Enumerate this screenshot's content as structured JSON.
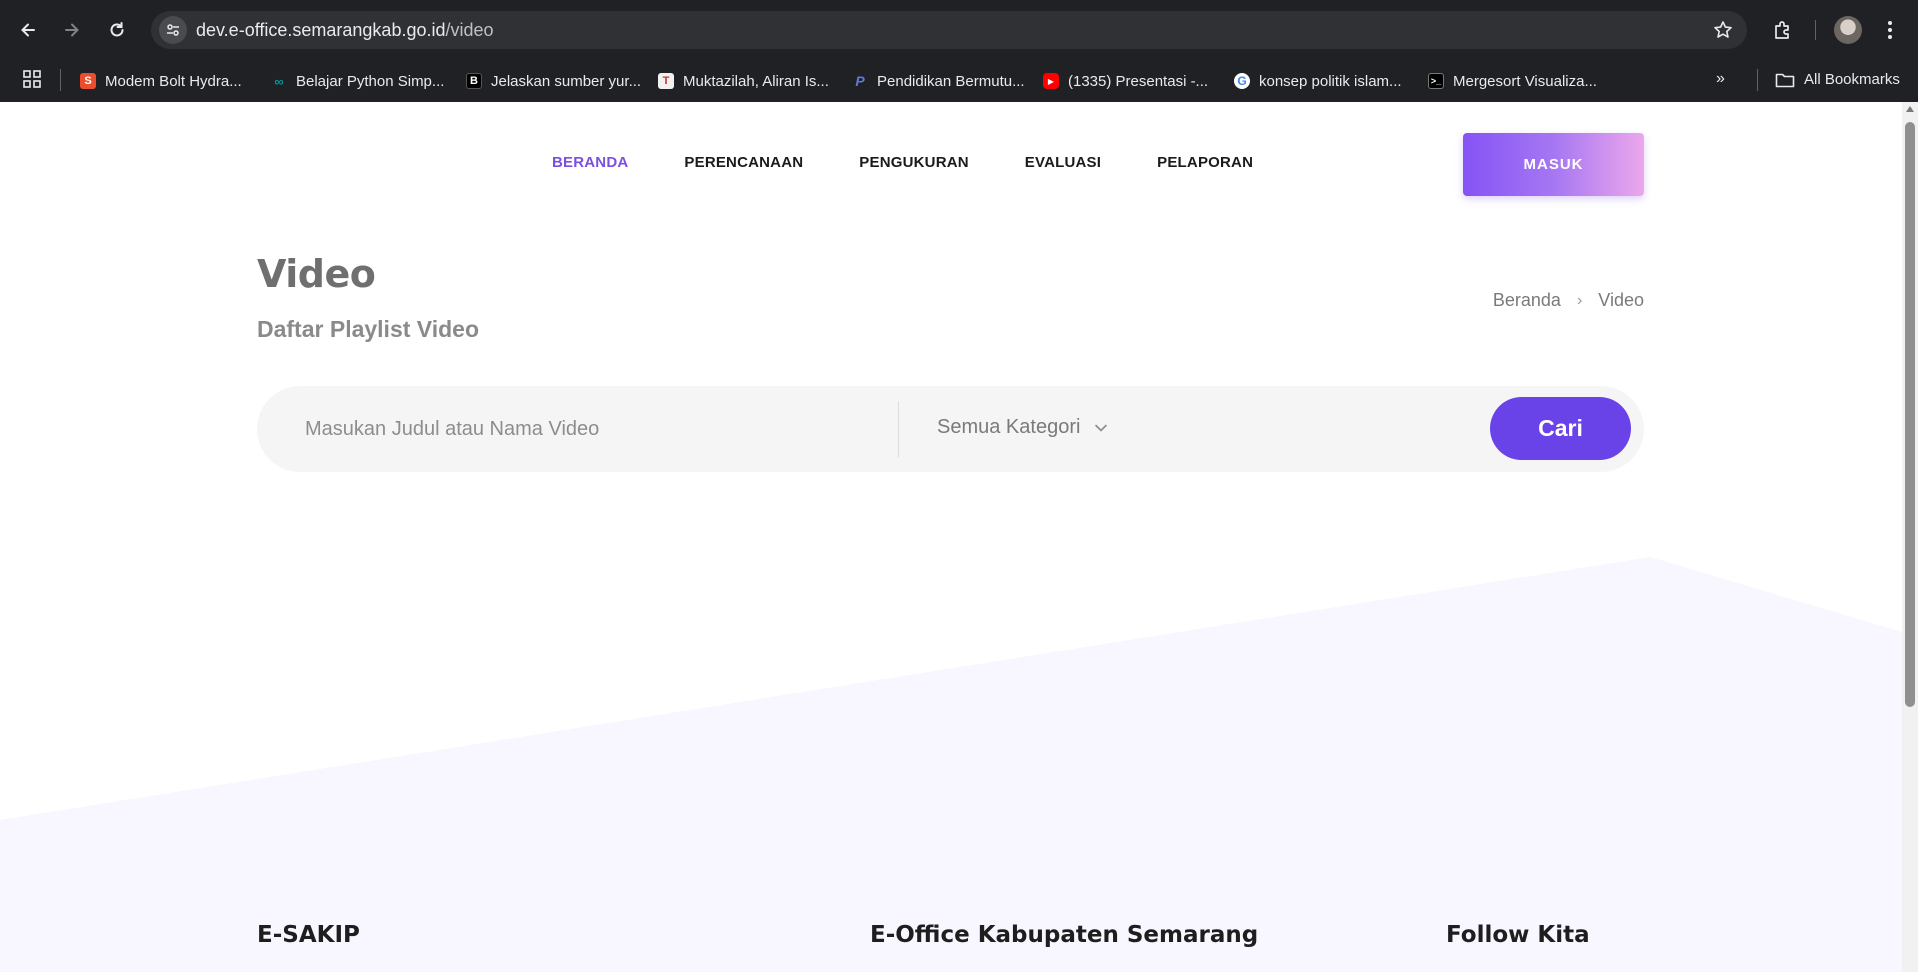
{
  "browser": {
    "url_host": "dev.e-office.semarangkab.go.id",
    "url_path": "/video",
    "bookmarks": [
      {
        "label": "Modem Bolt Hydra...",
        "icon": "shopee-icon",
        "color": "#ee4d2d"
      },
      {
        "label": "Belajar Python Simp...",
        "icon": "arduino-icon",
        "color": "#00979c"
      },
      {
        "label": "Jelaskan sumber yur...",
        "icon": "bing-chat-icon",
        "color": "#000000"
      },
      {
        "label": "Muktazilah, Aliran Is...",
        "icon": "tirto-icon",
        "color": "#d32f2f"
      },
      {
        "label": "Pendidikan Bermutu...",
        "icon": "paypal-icon",
        "color": "#253b80"
      },
      {
        "label": "(1335) Presentasi -...",
        "icon": "youtube-icon",
        "color": "#ff0000"
      },
      {
        "label": "konsep politik islam...",
        "icon": "google-icon",
        "color": "#4285f4"
      },
      {
        "label": "Mergesort Visualiza...",
        "icon": "terminal-icon",
        "color": "#000000"
      }
    ],
    "all_bookmarks_label": "All Bookmarks"
  },
  "nav": {
    "items": [
      {
        "label": "BERANDA",
        "active": true
      },
      {
        "label": "PERENCANAAN",
        "active": false
      },
      {
        "label": "PENGUKURAN",
        "active": false
      },
      {
        "label": "EVALUASI",
        "active": false
      },
      {
        "label": "PELAPORAN",
        "active": false
      }
    ],
    "login_label": "MASUK"
  },
  "header": {
    "title": "Video",
    "subtitle": "Daftar Playlist Video",
    "breadcrumb": {
      "home": "Beranda",
      "current": "Video"
    }
  },
  "search": {
    "placeholder": "Masukan Judul atau Nama Video",
    "category_selected": "Semua Kategori",
    "submit_label": "Cari"
  },
  "footer": {
    "col1": "E-SAKIP",
    "col2": "E-Office Kabupaten Semarang",
    "col3": "Follow Kita"
  },
  "colors": {
    "accent": "#6a43e8",
    "nav_active": "#7b4fe0",
    "gradient_start": "#8553f5",
    "gradient_end": "#eca7ec"
  }
}
